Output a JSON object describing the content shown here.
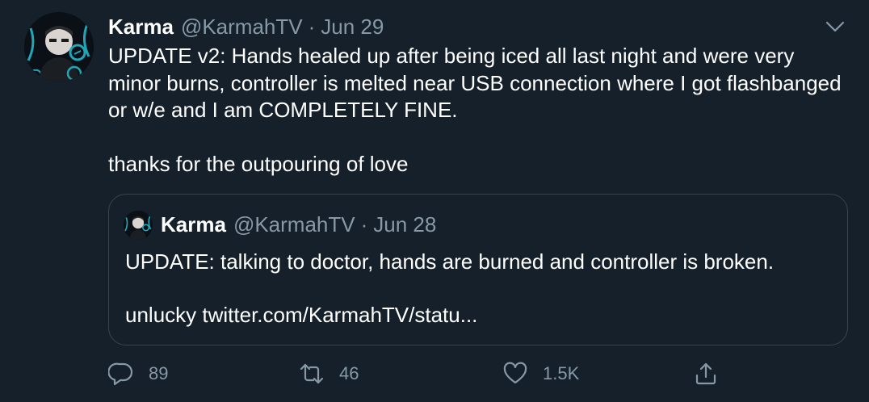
{
  "tweet": {
    "author_name": "Karma",
    "author_handle": "@KarmahTV",
    "separator": "·",
    "date": "Jun 29",
    "text": "UPDATE v2: Hands healed up after being iced all last night and were very minor burns, controller is melted near USB connection where I got flashbanged or w/e and I am COMPLETELY FINE.\n\nthanks for the outpouring of love"
  },
  "quoted_tweet": {
    "author_name": "Karma",
    "author_handle": "@KarmahTV",
    "separator": "·",
    "date": "Jun 28",
    "text": "UPDATE: talking to doctor, hands are burned and controller is broken.",
    "link_prefix": "unlucky ",
    "link_text": "twitter.com/KarmahTV/statu..."
  },
  "actions": {
    "replies": "89",
    "retweets": "46",
    "likes": "1.5K"
  },
  "icons": {
    "reply": "reply-icon",
    "retweet": "retweet-icon",
    "like": "heart-icon",
    "share": "share-icon",
    "more": "chevron-down-icon"
  },
  "colors": {
    "background": "#15202b",
    "secondary_text": "#8899a6",
    "border": "#38444d",
    "avatar_accent": "#1fa7b8"
  }
}
